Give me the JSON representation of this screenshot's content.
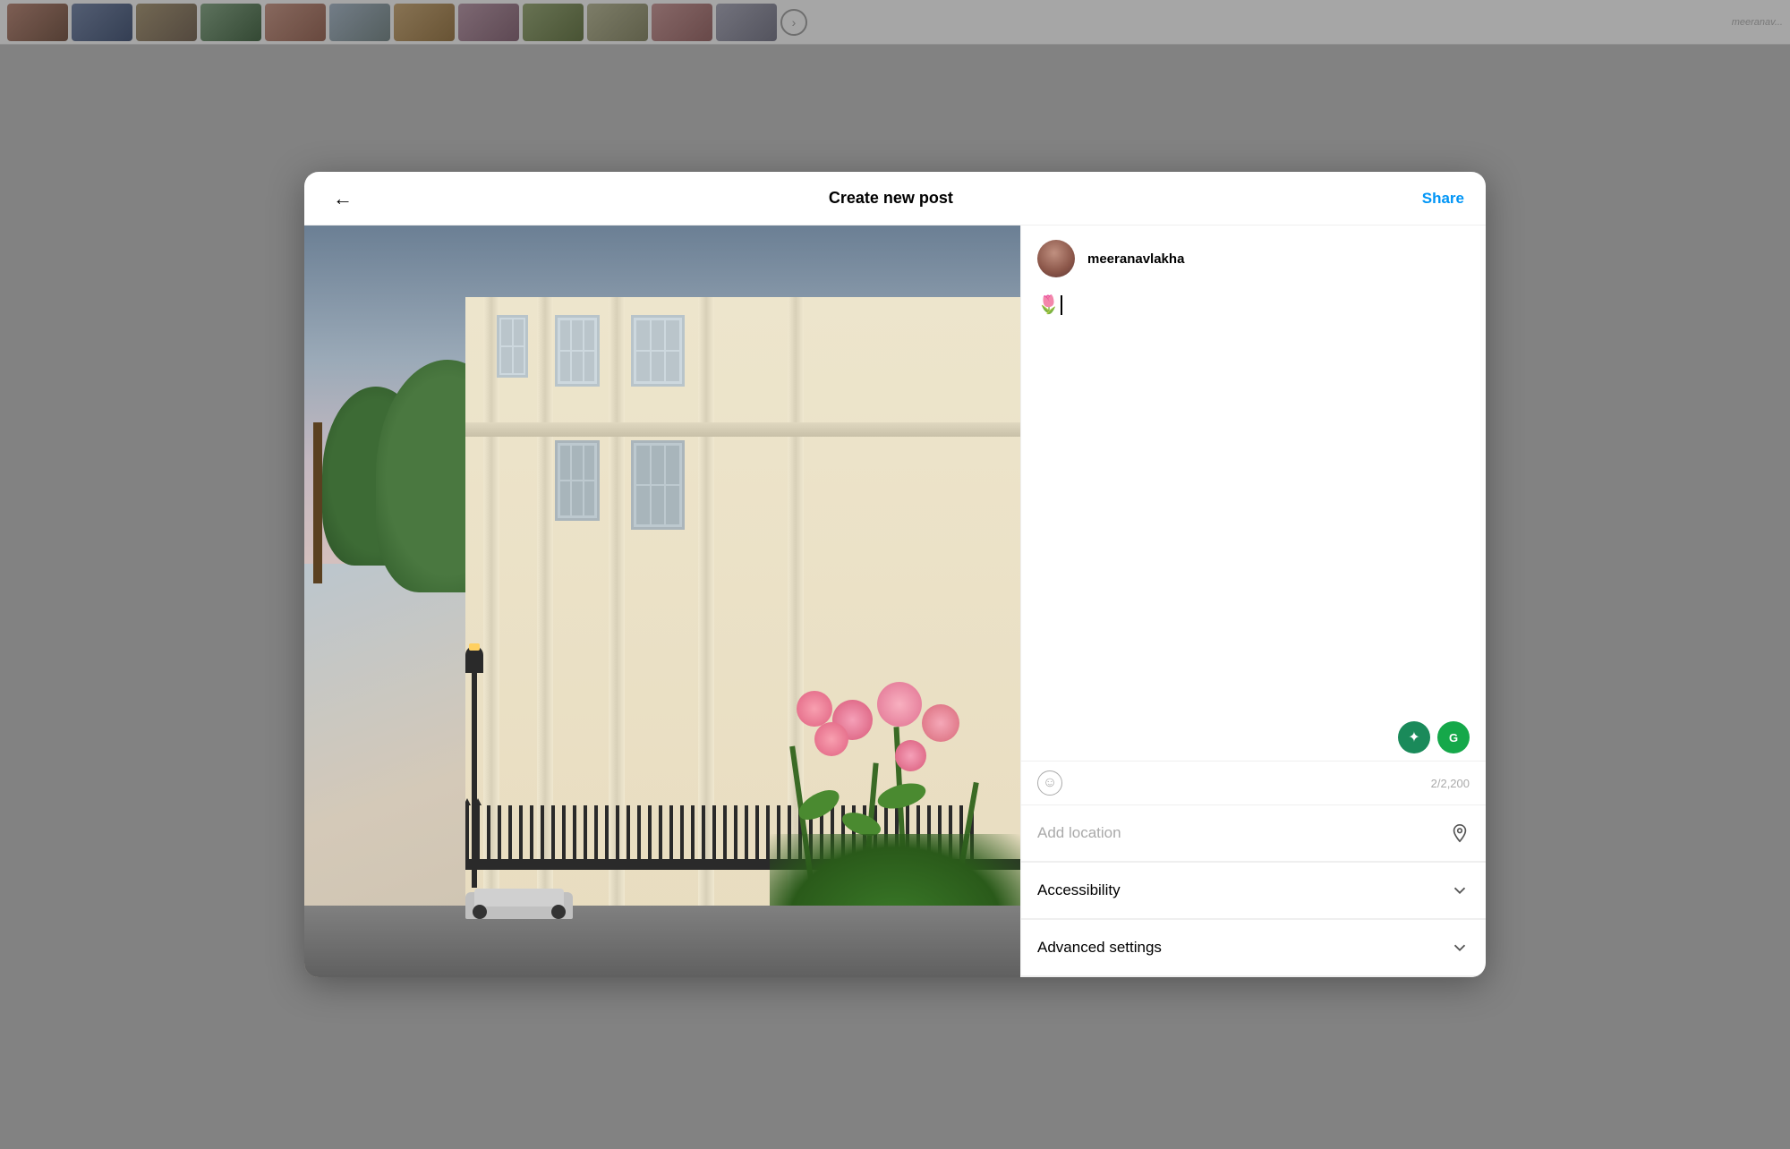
{
  "header": {
    "back_label": "←",
    "title": "Create new post",
    "share_label": "Share"
  },
  "user": {
    "username": "meeranavlakha",
    "avatar_alt": "profile picture"
  },
  "caption": {
    "emoji": "🌷",
    "placeholder": "",
    "char_count": "2/2,200"
  },
  "toolbar": {
    "emoji_btn_label": "☺",
    "ai_btn1_label": "✦",
    "ai_btn2_label": "G"
  },
  "sections": {
    "add_location": "Add location",
    "accessibility": "Accessibility",
    "advanced_settings": "Advanced settings"
  },
  "background": {
    "thumbnails": [
      "",
      "",
      "",
      "",
      "",
      "",
      "",
      "",
      "",
      "",
      "",
      ""
    ]
  }
}
